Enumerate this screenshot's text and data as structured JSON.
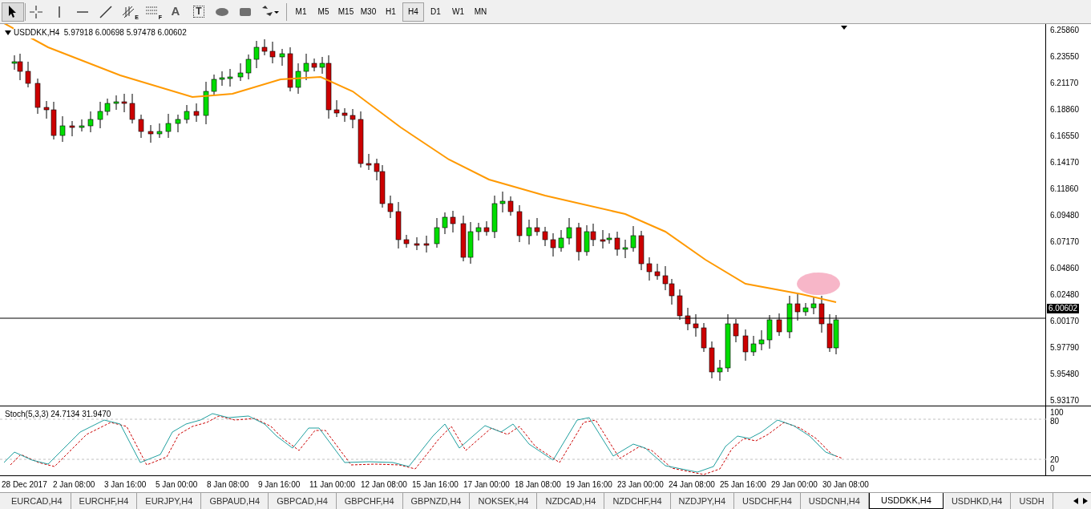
{
  "toolbar": {
    "tools": [
      {
        "kind": "cursor",
        "selected": true
      },
      {
        "kind": "crosshair",
        "selected": false
      },
      {
        "kind": "vline",
        "selected": false
      },
      {
        "kind": "hline",
        "selected": false
      },
      {
        "kind": "trend",
        "selected": false
      },
      {
        "kind": "channel",
        "label": "E",
        "selected": false
      },
      {
        "kind": "fibo",
        "label": "F",
        "selected": false
      },
      {
        "kind": "text",
        "label": "A",
        "selected": false
      },
      {
        "kind": "textlabel",
        "label": "T",
        "selected": false
      },
      {
        "kind": "ellipse",
        "selected": false
      },
      {
        "kind": "rect",
        "selected": false
      },
      {
        "kind": "arrows",
        "selected": false
      }
    ],
    "timeframes": [
      {
        "label": "M1",
        "selected": false
      },
      {
        "label": "M5",
        "selected": false
      },
      {
        "label": "M15",
        "selected": false
      },
      {
        "label": "M30",
        "selected": false
      },
      {
        "label": "H1",
        "selected": false
      },
      {
        "label": "H4",
        "selected": true
      },
      {
        "label": "D1",
        "selected": false
      },
      {
        "label": "W1",
        "selected": false
      },
      {
        "label": "MN",
        "selected": false
      }
    ]
  },
  "chart": {
    "title": "USDDKK,H4  5.97918 6.00698 5.97478 6.00602",
    "price_labels": [
      "6.25860",
      "6.23550",
      "6.21170",
      "6.18860",
      "6.16550",
      "6.14170",
      "6.11860",
      "6.09480",
      "6.07170",
      "6.04860",
      "6.02480",
      "6.00170",
      "5.97790",
      "5.95480",
      "5.93170"
    ],
    "current_price": "6.00602"
  },
  "indicator": {
    "title": "Stoch(5,3,3) 24.7134 31.9470",
    "levels": [
      "100",
      "80",
      "20",
      "0"
    ]
  },
  "time_labels": [
    "28 Dec 2017",
    "2 Jan 08:00",
    "3 Jan 16:00",
    "5 Jan 00:00",
    "8 Jan 08:00",
    "9 Jan 16:00",
    "11 Jan 00:00",
    "12 Jan 08:00",
    "15 Jan 16:00",
    "17 Jan 00:00",
    "18 Jan 08:00",
    "19 Jan 16:00",
    "23 Jan 00:00",
    "24 Jan 08:00",
    "25 Jan 16:00",
    "29 Jan 00:00",
    "30 Jan 08:00"
  ],
  "tabs": [
    {
      "label": "EURCAD,H4",
      "selected": false
    },
    {
      "label": "EURCHF,H4",
      "selected": false
    },
    {
      "label": "EURJPY,H4",
      "selected": false
    },
    {
      "label": "GBPAUD,H4",
      "selected": false
    },
    {
      "label": "GBPCAD,H4",
      "selected": false
    },
    {
      "label": "GBPCHF,H4",
      "selected": false
    },
    {
      "label": "GBPNZD,H4",
      "selected": false
    },
    {
      "label": "NOKSEK,H4",
      "selected": false
    },
    {
      "label": "NZDCAD,H4",
      "selected": false
    },
    {
      "label": "NZDCHF,H4",
      "selected": false
    },
    {
      "label": "NZDJPY,H4",
      "selected": false
    },
    {
      "label": "USDCHF,H4",
      "selected": false
    },
    {
      "label": "USDCNH,H4",
      "selected": false
    },
    {
      "label": "USDDKK,H4",
      "selected": true
    },
    {
      "label": "USDHKD,H4",
      "selected": false
    },
    {
      "label": "USDH",
      "selected": false
    }
  ]
}
